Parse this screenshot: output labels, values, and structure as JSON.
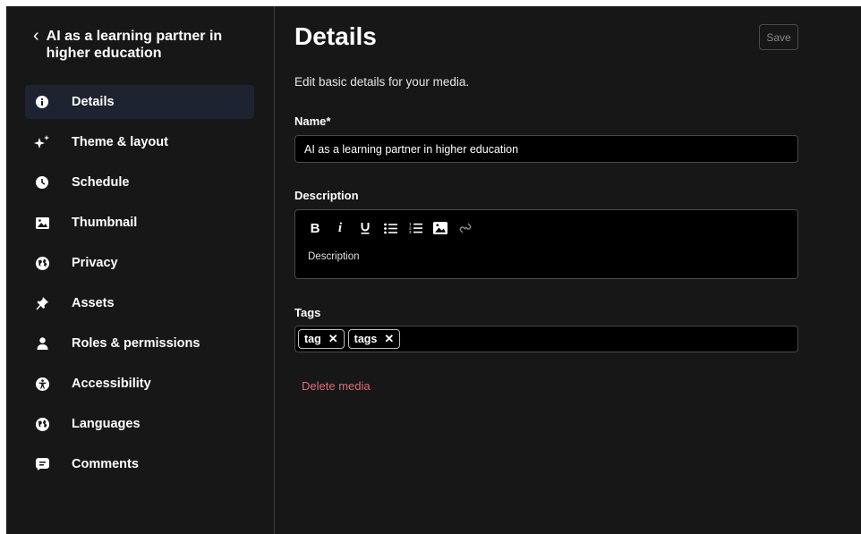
{
  "sidebar": {
    "back_title": "AI as a learning partner in higher education",
    "items": [
      {
        "label": "Details",
        "icon": "info-icon",
        "active": true
      },
      {
        "label": "Theme & layout",
        "icon": "sparkle-icon"
      },
      {
        "label": "Schedule",
        "icon": "clock-icon"
      },
      {
        "label": "Thumbnail",
        "icon": "image-icon"
      },
      {
        "label": "Privacy",
        "icon": "globe-icon"
      },
      {
        "label": "Assets",
        "icon": "pin-icon"
      },
      {
        "label": "Roles & permissions",
        "icon": "person-icon"
      },
      {
        "label": "Accessibility",
        "icon": "accessibility-icon"
      },
      {
        "label": "Languages",
        "icon": "globe-icon"
      },
      {
        "label": "Comments",
        "icon": "comment-icon"
      }
    ]
  },
  "main": {
    "title": "Details",
    "save_label": "Save",
    "subtitle": "Edit basic details for your media.",
    "name_label": "Name*",
    "name_value": "AI as a learning partner in higher education",
    "description_label": "Description",
    "description_placeholder": "Description",
    "toolbar": [
      "bold-icon",
      "italic-icon",
      "underline-icon",
      "bullet-list-icon",
      "numbered-list-icon",
      "image-icon",
      "link-icon"
    ],
    "tags_label": "Tags",
    "tags": [
      "tag",
      "tags"
    ],
    "delete_label": "Delete media"
  },
  "colors": {
    "background": "#171717",
    "active_nav": "#1d2330",
    "danger": "#e06b77"
  }
}
